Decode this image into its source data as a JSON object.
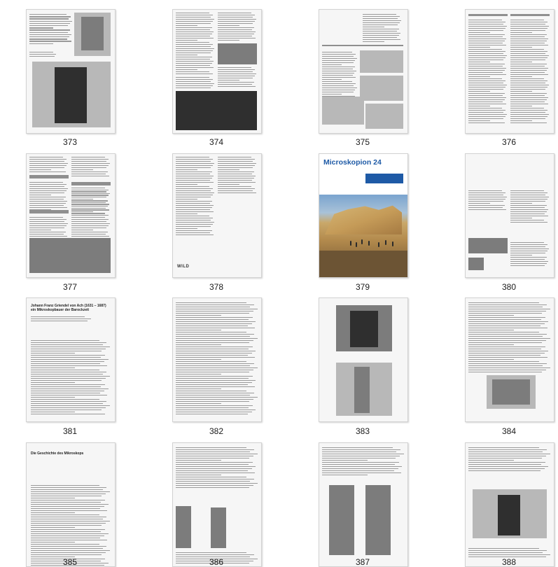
{
  "pages": [
    {
      "number": "373"
    },
    {
      "number": "374"
    },
    {
      "number": "375"
    },
    {
      "number": "376"
    },
    {
      "number": "377"
    },
    {
      "number": "378"
    },
    {
      "number": "379"
    },
    {
      "number": "380"
    },
    {
      "number": "381"
    },
    {
      "number": "382"
    },
    {
      "number": "383"
    },
    {
      "number": "384"
    },
    {
      "number": "385"
    },
    {
      "number": "386"
    },
    {
      "number": "387"
    },
    {
      "number": "388"
    }
  ],
  "cover": {
    "title": "Microskopion",
    "issue": "24",
    "brand": "WILD"
  },
  "labels": {
    "p377_heading": "Wild Heerbrugg",
    "p378_logo": "WILD",
    "p381_title": "Johann Franz Griendel von Ach (1631 – 1687) ein Mikroskopbauer der Barockzeit",
    "p385_title": "Die Geschichte des Mikroskops"
  }
}
